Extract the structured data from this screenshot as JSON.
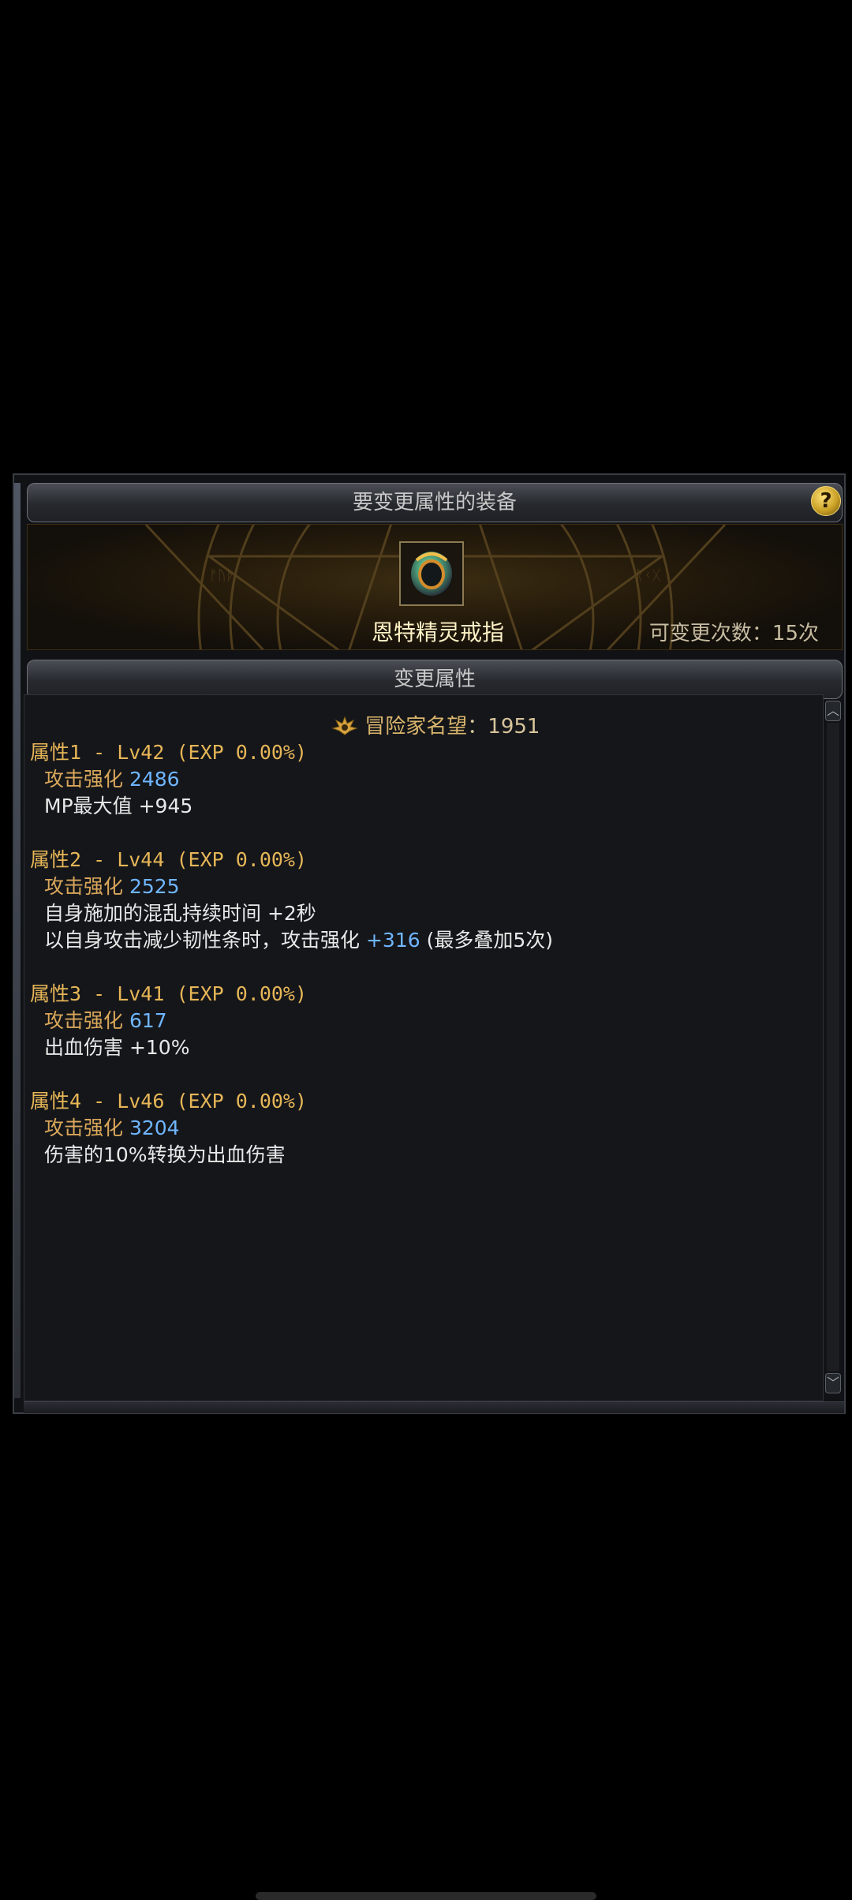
{
  "header": {
    "equipment_title": "要变更属性的装备",
    "help_label": "?"
  },
  "item": {
    "name": "恩特精灵戒指",
    "icon": "ring-icon",
    "change_count_label": "可变更次数：15次"
  },
  "attributes_section": {
    "title": "变更属性"
  },
  "reputation": {
    "icon": "reputation-emblem-icon",
    "label": "冒险家名望",
    "separator": "：",
    "value": "1951"
  },
  "attributes": [
    {
      "title": "属性1 - Lv42 (EXP 0.00%)",
      "lines": [
        {
          "label": "攻击强化",
          "value": "2486"
        },
        {
          "label": "MP最大值 +945",
          "value": ""
        }
      ]
    },
    {
      "title": "属性2 - Lv44 (EXP 0.00%)",
      "lines": [
        {
          "label": "攻击强化",
          "value": "2525"
        },
        {
          "label": "自身施加的混乱持续时间 +2秒",
          "value": ""
        },
        {
          "label": "以自身攻击减少韧性条时，攻击强化",
          "value": "+316",
          "suffix": "(最多叠加5次)"
        }
      ]
    },
    {
      "title": "属性3 - Lv41 (EXP 0.00%)",
      "lines": [
        {
          "label": "攻击强化",
          "value": "617"
        },
        {
          "label": "出血伤害 +10%",
          "value": ""
        }
      ]
    },
    {
      "title": "属性4 - Lv46 (EXP 0.00%)",
      "lines": [
        {
          "label": "攻击强化",
          "value": "3204"
        },
        {
          "label": "伤害的10%转换为出血伤害",
          "value": ""
        }
      ]
    }
  ],
  "colors": {
    "gold": "#e6b657",
    "blue_value": "#6fb6ff",
    "panel_bg": "#15161a"
  }
}
